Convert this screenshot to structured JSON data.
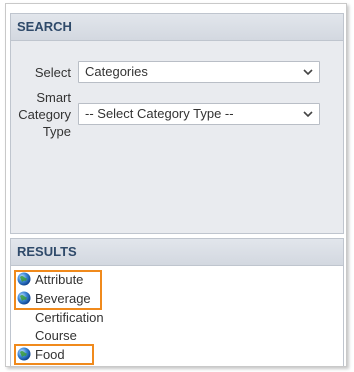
{
  "search": {
    "header": "SEARCH",
    "select_label": "Select",
    "select_value": "Categories",
    "smart_label_line1": "Smart",
    "smart_label_line2": "Category",
    "smart_label_line3": "Type",
    "smart_value": "-- Select Category Type --"
  },
  "results": {
    "header": "RESULTS",
    "items": [
      {
        "label": "Attribute",
        "icon": "globe-icon",
        "highlighted": true
      },
      {
        "label": "Beverage",
        "icon": "globe-icon",
        "highlighted": true
      },
      {
        "label": "Certification",
        "icon": null,
        "highlighted": false
      },
      {
        "label": "Course",
        "icon": null,
        "highlighted": false
      },
      {
        "label": "Food",
        "icon": "globe-icon",
        "highlighted": true
      }
    ]
  },
  "colors": {
    "header_text": "#2f4a6a",
    "highlight": "#f08a1c",
    "panel_bg": "#e9ebef"
  }
}
